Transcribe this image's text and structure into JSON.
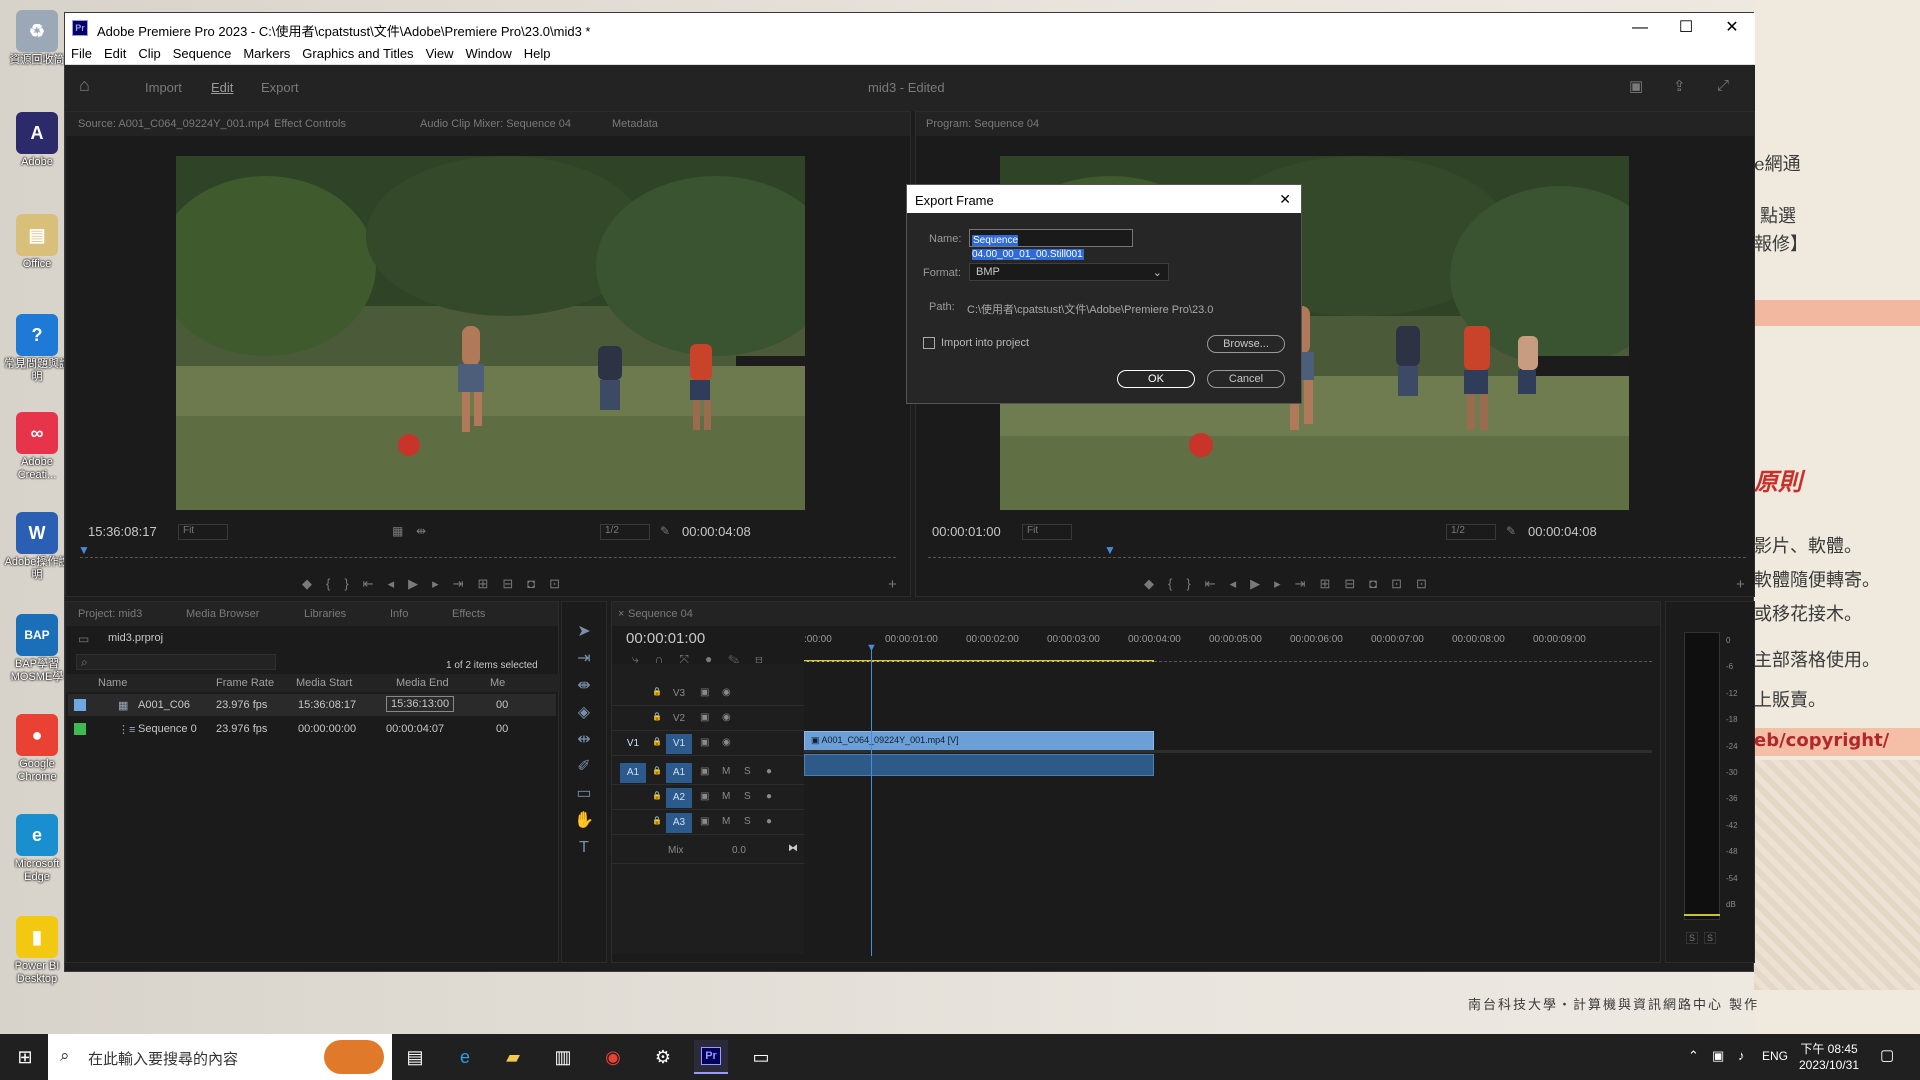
{
  "desktop": {
    "icons": [
      {
        "label": "資源回收筒",
        "icon": "recycle-bin-icon",
        "color": "#9aa8b8",
        "glyph": "♻"
      },
      {
        "label": "Adobe",
        "icon": "adobe-folder-icon",
        "color": "#2d2a6b",
        "glyph": "A"
      },
      {
        "label": "Office",
        "icon": "office-icon",
        "color": "#d9c07a",
        "glyph": "▤"
      },
      {
        "label": "常見問題與說明",
        "icon": "help-icon",
        "color": "#1e7ad6",
        "glyph": "?"
      },
      {
        "label": "Adobe Creati...",
        "icon": "creative-cloud-icon",
        "color": "#e8344b",
        "glyph": "∞"
      },
      {
        "label": "Adobe操作說明",
        "icon": "word-doc-icon",
        "color": "#2b5fb4",
        "glyph": "W"
      },
      {
        "label": "BAP學習 MOSME學",
        "icon": "bap-icon",
        "color": "#1a6fb8",
        "glyph": "BAP"
      },
      {
        "label": "Google Chrome",
        "icon": "chrome-icon",
        "color": "#e94235",
        "glyph": "●"
      },
      {
        "label": "Microsoft Edge",
        "icon": "edge-icon",
        "color": "#1a8fd0",
        "glyph": "e"
      },
      {
        "label": "Power BI Desktop",
        "icon": "powerbi-icon",
        "color": "#f2c811",
        "glyph": "▮"
      }
    ],
    "bg_texts": [
      "e網通",
      "點選",
      "報修】",
      "原則",
      "影片、軟體。",
      "軟體隨便轉寄。",
      "或移花接木。",
      "主部落格使用。",
      "上販賣。",
      "eb/copyright/",
      "南台科技大學・計算機與資訊網路中心 製作"
    ]
  },
  "window": {
    "title": "Adobe Premiere Pro 2023 - C:\\使用者\\cpatstust\\文件\\Adobe\\Premiere Pro\\23.0\\mid3 *",
    "controls": {
      "minimize": "—",
      "maximize": "☐",
      "close": "✕"
    }
  },
  "menu": [
    "File",
    "Edit",
    "Clip",
    "Sequence",
    "Markers",
    "Graphics and Titles",
    "View",
    "Window",
    "Help"
  ],
  "header": {
    "tabs": [
      "Import",
      "Edit",
      "Export"
    ],
    "active_tab": "Edit",
    "project_title": "mid3 - Edited"
  },
  "source_panel": {
    "tabs": [
      "Source: A001_C064_09224Y_001.mp4",
      "Effect Controls",
      "Audio Clip Mixer: Sequence 04",
      "Metadata"
    ],
    "timecode": "15:36:08:17",
    "fit": "Fit",
    "resolution": "1/2",
    "duration": "00:00:04:08"
  },
  "program_panel": {
    "tabs": [
      "Program: Sequence 04"
    ],
    "timecode": "00:00:01:00",
    "fit": "Fit",
    "resolution": "1/2",
    "duration": "00:00:04:08"
  },
  "project_panel": {
    "tabs": [
      "Project: mid3",
      "Media Browser",
      "Libraries",
      "Info",
      "Effects"
    ],
    "file": "mid3.prproj",
    "selection_info": "1 of 2 items selected",
    "columns": [
      "Name",
      "Frame Rate",
      "Media Start",
      "Media End",
      "Me"
    ],
    "rows": [
      {
        "name": "A001_C06",
        "frame_rate": "23.976 fps",
        "media_start": "15:36:08:17",
        "media_end": "15:36:13:00",
        "extra": "00",
        "color": "#6fa7e0"
      },
      {
        "name": "Sequence 0",
        "frame_rate": "23.976 fps",
        "media_start": "00:00:00:00",
        "media_end": "00:00:04:07",
        "extra": "00",
        "color": "#3dbb52"
      }
    ]
  },
  "timeline": {
    "tab": "Sequence 04",
    "timecode": "00:00:01:00",
    "ruler": [
      ":00:00",
      "00:00:01:00",
      "00:00:02:00",
      "00:00:03:00",
      "00:00:04:00",
      "00:00:05:00",
      "00:00:06:00",
      "00:00:07:00",
      "00:00:08:00",
      "00:00:09:00"
    ],
    "video_tracks": [
      "V3",
      "V2",
      "V1"
    ],
    "audio_tracks": [
      "A1",
      "A2",
      "A3"
    ],
    "source_v": "V1",
    "source_a": "A1",
    "mix_label": "Mix",
    "mix_value": "0.0",
    "clip_label": "A001_C064_09224Y_001.mp4 [V]",
    "track_buttons": {
      "mute": "M",
      "solo": "S"
    }
  },
  "audio_meter": {
    "scale": [
      "0",
      "-6",
      "-12",
      "-18",
      "-24",
      "-30",
      "-36",
      "-42",
      "-48",
      "-54",
      "dB"
    ],
    "buttons": [
      "S",
      "S"
    ]
  },
  "export_dialog": {
    "title": "Export Frame",
    "name_label": "Name:",
    "name_value": "Sequence 04.00_00_01_00.Still001",
    "format_label": "Format:",
    "format_value": "BMP",
    "path_label": "Path:",
    "path_value": "C:\\使用者\\cpatstust\\文件\\Adobe\\Premiere Pro\\23.0",
    "import_label": "Import into project",
    "browse": "Browse...",
    "ok": "OK",
    "cancel": "Cancel"
  },
  "taskbar": {
    "search_placeholder": "在此輸入要搜尋的內容",
    "language": "ENG",
    "time": "下午 08:45",
    "date": "2023/10/31"
  }
}
